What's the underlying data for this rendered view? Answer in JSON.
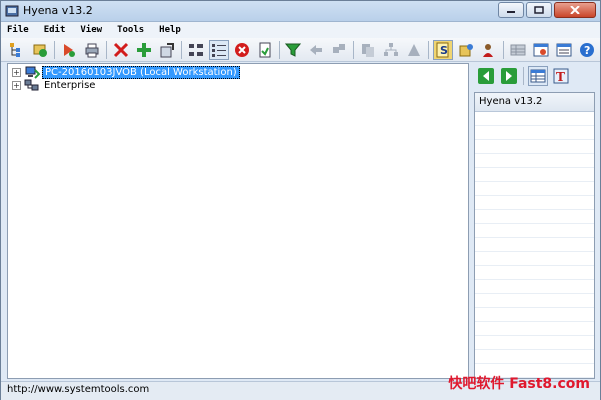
{
  "window": {
    "title": "Hyena v13.2"
  },
  "menu": [
    "File",
    "Edit",
    "View",
    "Tools",
    "Help"
  ],
  "toolbar": [
    {
      "name": "tree-icon"
    },
    {
      "name": "refresh-tree-icon"
    },
    {
      "name": "add-object-icon"
    },
    {
      "name": "print-icon"
    },
    {
      "name": "delete-icon"
    },
    {
      "name": "add-icon"
    },
    {
      "name": "properties-icon"
    },
    {
      "name": "layout-icon"
    },
    {
      "name": "list-view-icon"
    },
    {
      "name": "stop-icon"
    },
    {
      "name": "export-icon"
    },
    {
      "name": "filter-icon"
    },
    {
      "name": "back-nav-icon"
    },
    {
      "name": "shuffle-icon"
    },
    {
      "name": "copy-icon"
    },
    {
      "name": "hierarchy-icon"
    },
    {
      "name": "shape-icon"
    },
    {
      "name": "script-icon"
    },
    {
      "name": "settings-icon"
    },
    {
      "name": "user-icon"
    },
    {
      "name": "grid-icon"
    },
    {
      "name": "window-icon"
    },
    {
      "name": "panel-icon"
    },
    {
      "name": "help-icon"
    }
  ],
  "tree": {
    "items": [
      {
        "label": "PC-20160103JVOB (Local Workstation)",
        "selected": true
      },
      {
        "label": "Enterprise",
        "selected": false
      }
    ]
  },
  "right_panel": {
    "header": "Hyena v13.2"
  },
  "status": {
    "url": "http://www.systemtools.com"
  },
  "watermark": "快吧软件 Fast8.com",
  "colors": {
    "accent": "#3399ff",
    "watermark": "#e0182d"
  }
}
